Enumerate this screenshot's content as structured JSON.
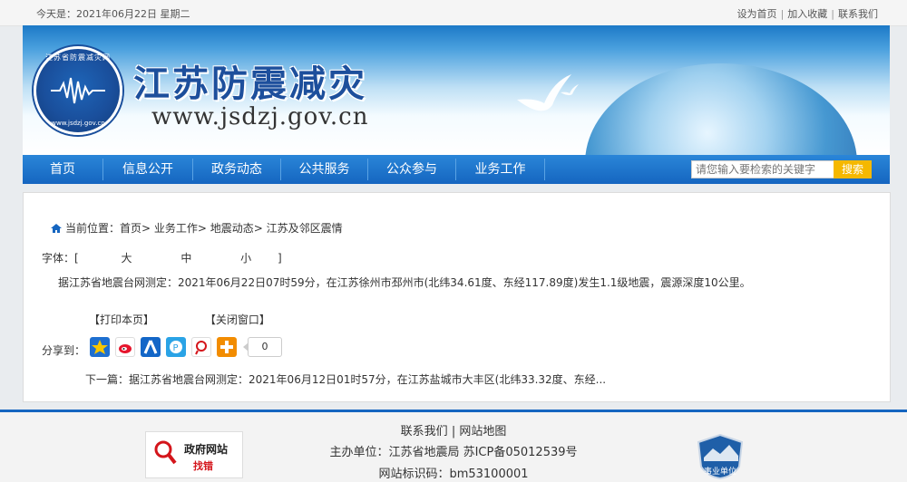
{
  "topbar": {
    "date": "今天是：2021年06月22日  星期二",
    "links": [
      "设为首页",
      "加入收藏",
      "联系我们"
    ]
  },
  "header": {
    "logo_ring": "江苏省防震减灾网",
    "logo_url": "www.jsdzj.gov.cn",
    "site_title": "江苏防震减灾",
    "site_url": "www.jsdzj.gov.cn"
  },
  "nav": {
    "items": [
      "首页",
      "信息公开",
      "政务动态",
      "公共服务",
      "公众参与",
      "业务工作"
    ],
    "search_placeholder": "请您输入要检索的关键字",
    "search_button": "搜索"
  },
  "content": {
    "breadcrumb": "当前位置：首页> 业务工作> 地震动态> 江苏及邻区震情",
    "font_label": "字体：[",
    "font_options": [
      "大",
      "中",
      "小"
    ],
    "font_close": "]",
    "article": "据江苏省地震台网测定：2021年06月22日07时59分，在江苏徐州市邳州市(北纬34.61度、东经117.89度)发生1.1级地震，震源深度10公里。",
    "print": "【打印本页】",
    "close": "【关闭窗口】",
    "share_label": "分享到：",
    "share_count": "0",
    "next_label": "下一篇：",
    "next_title": "据江苏省地震台网测定：2021年06月12日01时57分，在江苏盐城市大丰区(北纬33.32度、东经..."
  },
  "footer": {
    "links": [
      "联系我们",
      "网站地图"
    ],
    "host": "主办单位：江苏省地震局 苏ICP备05012539号",
    "site_code": "网站标识码：bm53100001",
    "gov_badge": [
      "政府网站",
      "找错"
    ],
    "sy_badge": "事业单位"
  },
  "colors": {
    "nav_blue": "#1565c0",
    "search_button": "#f5b800",
    "badge_red": "#d4151b"
  }
}
